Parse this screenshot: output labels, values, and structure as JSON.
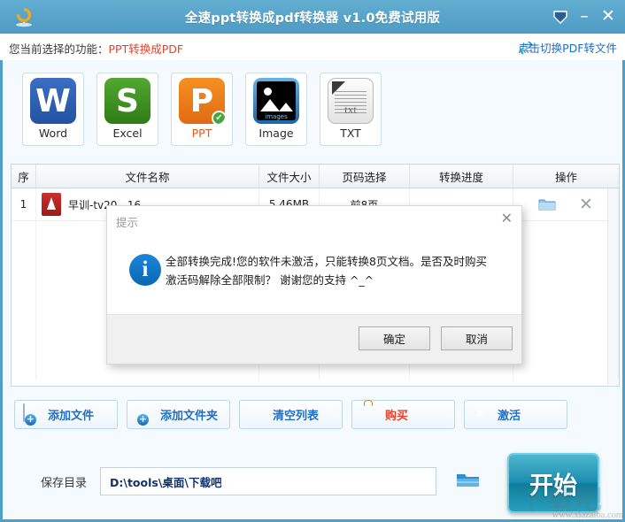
{
  "window": {
    "title": "全速ppt转换成pdf转换器 v1.0免费试用版",
    "app_icon": "refresh-circle-icon",
    "tray_icon": "minimize-to-tray-icon",
    "minimize_label": "–",
    "close_label": "✕",
    "accent_color": "#57a3c9"
  },
  "subheader": {
    "function_label": "您当前选择的功能：",
    "function_value": "PPT转换成PDF",
    "function_value_color": "#e8402a",
    "switch_link": "点击切换PDF转文件",
    "switch_icon": "swap-arrows-icon",
    "link_color": "#1f6fc4"
  },
  "formats": [
    {
      "id": "word",
      "label": "Word",
      "glyph": "W",
      "icon": "word-icon",
      "selected": false
    },
    {
      "id": "excel",
      "label": "Excel",
      "glyph": "S",
      "icon": "excel-icon",
      "selected": false
    },
    {
      "id": "ppt",
      "label": "PPT",
      "glyph": "P",
      "icon": "ppt-icon",
      "selected": true,
      "check": "✔"
    },
    {
      "id": "image",
      "label": "Image",
      "glyph": "images",
      "icon": "image-icon",
      "selected": false
    },
    {
      "id": "txt",
      "label": "TXT",
      "glyph": "txt",
      "icon": "txt-icon",
      "selected": false
    }
  ],
  "table": {
    "headers": [
      "序",
      "文件名称",
      "文件大小",
      "页码选择",
      "转换进度",
      "操作"
    ],
    "rows": [
      {
        "index": "1",
        "filename": "早训-tv20...16",
        "file_icon": "pdf-file-icon",
        "size": "5.46MB",
        "pages": "前8页",
        "progress": "",
        "open_icon": "open-folder-icon",
        "delete_icon": "delete-x-icon"
      }
    ]
  },
  "actions": [
    {
      "id": "add-file",
      "label": "添加文件",
      "icon": "add-file-icon",
      "color": "#1f6fc4"
    },
    {
      "id": "add-folder",
      "label": "添加文件夹",
      "icon": "add-folder-icon",
      "color": "#1f6fc4"
    },
    {
      "id": "clear-list",
      "label": "清空列表",
      "icon": "trash-bin-icon",
      "color": "#1f6fc4"
    },
    {
      "id": "buy",
      "label": "购买",
      "icon": "shopping-bag-icon",
      "color": "#e8402a"
    },
    {
      "id": "activate",
      "label": "激活",
      "icon": "arrow-circle-icon",
      "color": "#1f6fc4"
    }
  ],
  "save": {
    "label": "保存目录",
    "path": "D:\\tools\\桌面\\下载吧",
    "browse_icon": "browse-folder-icon",
    "start_label": "开始"
  },
  "watermark": {
    "big": "下载吧",
    "url": "www.xiazaiba.com"
  },
  "dialog": {
    "title": "提示",
    "close_label": "✕",
    "info_icon": "info-circle-icon",
    "info_glyph": "i",
    "message": "全部转换完成!您的软件未激活，只能转换8页文档。是否及时购买激活码解除全部限制？ 谢谢您的支持 ^_^",
    "ok_label": "确定",
    "cancel_label": "取消"
  }
}
